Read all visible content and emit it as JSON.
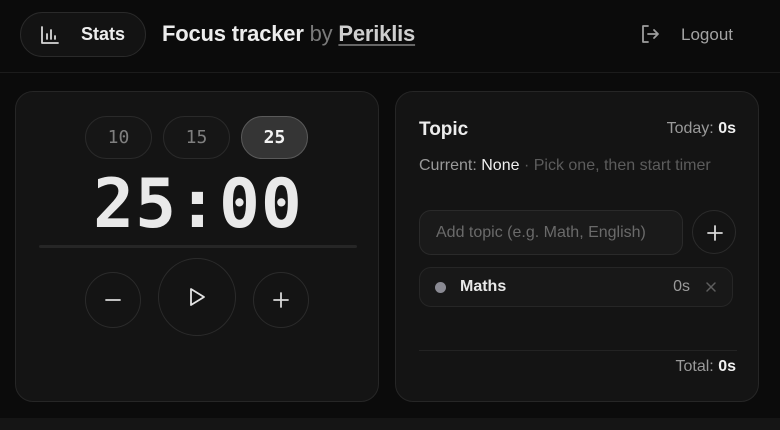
{
  "header": {
    "stats_label": "Stats",
    "app_title": "Focus tracker",
    "by_text": "by",
    "author": "Periklis",
    "logout_label": "Logout"
  },
  "timer": {
    "presets": [
      "10",
      "15",
      "25"
    ],
    "active_preset": "25",
    "display": "25:00",
    "progress": 0
  },
  "topic": {
    "title": "Topic",
    "today_label": "Today:",
    "today_value": "0s",
    "current_label": "Current:",
    "current_value": "None",
    "current_hint": "· Pick one, then start timer",
    "input_placeholder": "Add topic (e.g. Math, English)",
    "input_value": "",
    "items": [
      {
        "name": "Maths",
        "time": "0s",
        "dot_color": "#8a8a93"
      }
    ],
    "total_label": "Total:",
    "total_value": "0s"
  },
  "colors": {
    "background": "#0b0b0b",
    "card": "#141414",
    "active_preset": "#353535"
  },
  "icons": [
    "bar-chart-icon",
    "logout-icon",
    "minus-icon",
    "play-icon",
    "plus-icon",
    "close-icon"
  ]
}
